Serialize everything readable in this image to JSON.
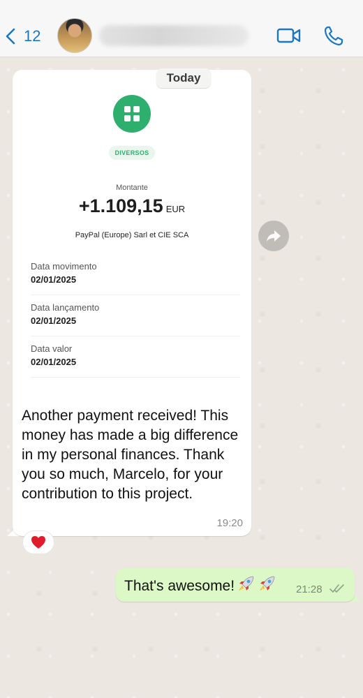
{
  "header": {
    "back_count": "12",
    "icons": {
      "back": "chevron-left-icon",
      "video": "video-camera-icon",
      "call": "phone-icon"
    },
    "accent_color": "#1a78c2"
  },
  "chat": {
    "date_label": "Today",
    "incoming": {
      "receipt": {
        "category": "DIVERSOS",
        "amount_label": "Montante",
        "amount_value": "+1.109,15",
        "currency": "EUR",
        "payer": "PayPal (Europe) Sarl et CIE SCA",
        "details": [
          {
            "label": "Data movimento",
            "value": "02/01/2025"
          },
          {
            "label": "Data lançamento",
            "value": "02/01/2025"
          },
          {
            "label": "Data valor",
            "value": "02/01/2025"
          }
        ],
        "brand_color": "#2eaf6e"
      },
      "text": "Another payment received! This money has made a big difference in my personal finances. Thank you so much, Marcelo, for your contribution to this project.",
      "time": "19:20",
      "reaction": "heart-icon"
    },
    "outgoing": {
      "text": "That's awesome!",
      "emoji": "rocket-icon",
      "time": "21:28",
      "status": "double-check-icon",
      "bubble_color": "#dcf8c6"
    }
  }
}
